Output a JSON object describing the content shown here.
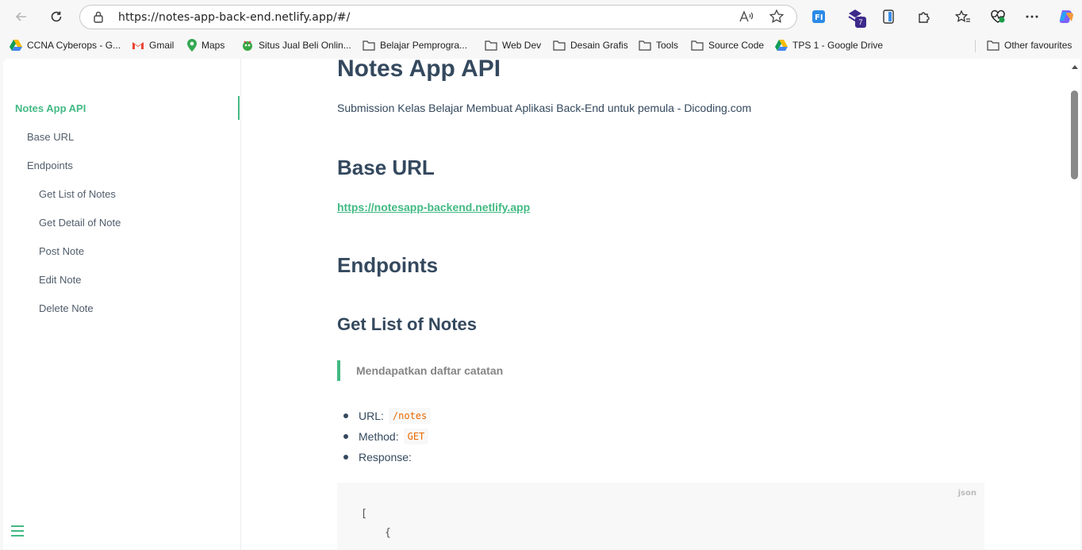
{
  "browser": {
    "url": "https://notes-app-back-end.netlify.app/#/",
    "extension_badge": "7",
    "extension_icons": [
      "translate-extension-icon",
      "puzzle-extension-icon",
      "phone-extension-icon",
      "extensions-icon",
      "favourites-icon",
      "performance-icon",
      "more-icon",
      "copilot-icon"
    ],
    "bookmarks": [
      {
        "label": "CCNA Cyberops - G...",
        "icon": "google-drive-icon"
      },
      {
        "label": "Gmail",
        "icon": "gmail-icon"
      },
      {
        "label": "Maps",
        "icon": "maps-icon"
      },
      {
        "label": "Situs Jual Beli Onlin...",
        "icon": "shop-icon"
      },
      {
        "label": "Belajar Pemprogra...",
        "icon": "folder-icon"
      },
      {
        "label": "Web Dev",
        "icon": "folder-icon"
      },
      {
        "label": "Desain Grafis",
        "icon": "folder-icon"
      },
      {
        "label": "Tools",
        "icon": "folder-icon"
      },
      {
        "label": "Source Code",
        "icon": "folder-icon"
      },
      {
        "label": "TPS 1 - Google Drive",
        "icon": "google-drive-icon"
      }
    ],
    "other_favourites": "Other favourites"
  },
  "sidebar": {
    "items": [
      {
        "label": "Notes App API",
        "active": true
      },
      {
        "label": "Base URL"
      },
      {
        "label": "Endpoints"
      },
      {
        "label": "Get List of Notes"
      },
      {
        "label": "Get Detail of Note"
      },
      {
        "label": "Post Note"
      },
      {
        "label": "Edit Note"
      },
      {
        "label": "Delete Note"
      }
    ]
  },
  "content": {
    "title": "Notes App API",
    "description": "Submission Kelas Belajar Membuat Aplikasi Back-End untuk pemula - Dicoding.com",
    "base_url_heading": "Base URL",
    "base_url_link": "https://notesapp-backend.netlify.app",
    "endpoints_heading": "Endpoints",
    "get_list_heading": "Get List of Notes",
    "get_list_quote": "Mendapatkan daftar catatan",
    "list": {
      "url_label": "URL:",
      "url_value": "/notes",
      "method_label": "Method:",
      "method_value": "GET",
      "response_label": "Response:"
    },
    "code": {
      "lang": "json",
      "line1": "[",
      "line2": "{"
    }
  },
  "colors": {
    "accent": "#42b983",
    "heading": "#34495e",
    "code": "#e96900"
  }
}
